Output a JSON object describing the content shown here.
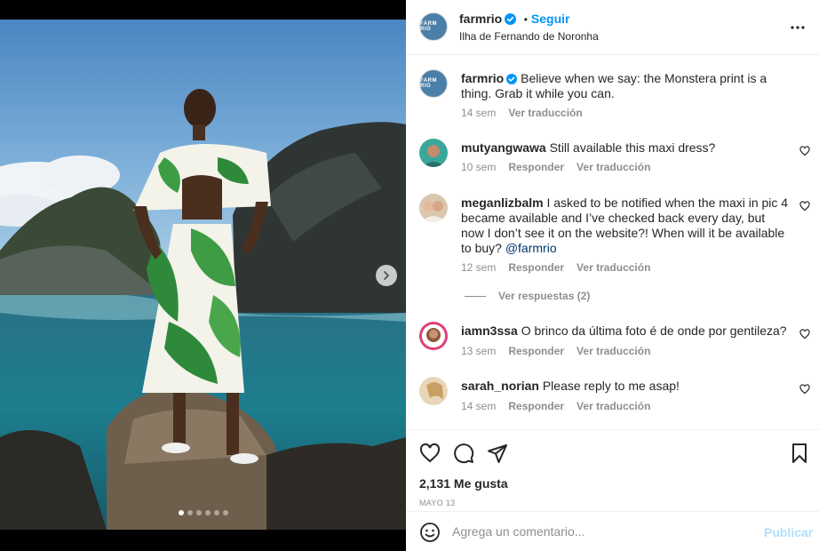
{
  "header": {
    "username": "farmrio",
    "follow_label": "Seguir",
    "dot": "•",
    "location": "Ilha de Fernando de Noronha",
    "avatar_text": "FARM RIO"
  },
  "caption": {
    "username": "farmrio",
    "text": "Believe when we say: the Monstera print is a thing. Grab it while you can.",
    "time": "14 sem",
    "translate": "Ver traducción"
  },
  "comments": [
    {
      "username": "mutyangwawa",
      "text": "Still available this maxi dress?",
      "time": "10 sem",
      "reply": "Responder",
      "translate": "Ver traducción"
    },
    {
      "username": "meganlizbalm",
      "text": "I asked to be notified when the maxi in pic 4 became available and I’ve checked back every day, but now I don’t see it on the website?! When will it be available to buy?",
      "mention": "@farmrio",
      "time": "12 sem",
      "reply": "Responder",
      "translate": "Ver traducción"
    },
    {
      "username": "iamn3ssa",
      "text": "O brinco da última foto é de onde por gentileza?",
      "time": "13 sem",
      "reply": "Responder",
      "translate": "Ver traducción"
    },
    {
      "username": "sarah_norian",
      "text": "Please reply to me asap!",
      "time": "14 sem",
      "reply": "Responder",
      "translate": "Ver traducción"
    }
  ],
  "view_replies": "Ver respuestas (2)",
  "likes": "2,131 Me gusta",
  "date": "MAYO 13",
  "composer": {
    "placeholder": "Agrega un comentario...",
    "publish": "Publicar"
  },
  "carousel": {
    "count": 6,
    "active_index": 0
  },
  "colors": {
    "accent": "#0095f6",
    "publish_disabled": "#b2dffc",
    "muted": "#8e8e8e",
    "text": "#262626"
  }
}
